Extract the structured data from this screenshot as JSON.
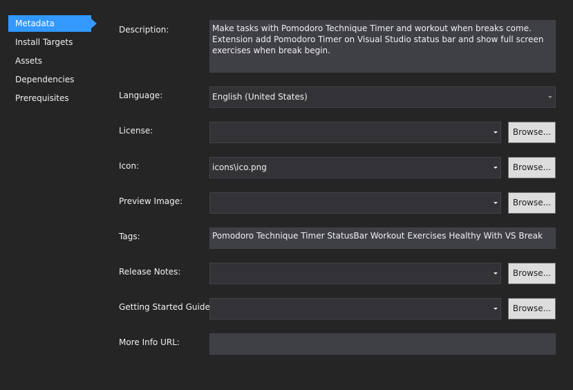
{
  "sidebar": {
    "items": [
      {
        "label": "Metadata"
      },
      {
        "label": "Install Targets"
      },
      {
        "label": "Assets"
      },
      {
        "label": "Dependencies"
      },
      {
        "label": "Prerequisites"
      }
    ],
    "selected": "Metadata"
  },
  "form": {
    "description": {
      "label": "Description:",
      "value": "Make tasks with Pomodoro Technique Timer and workout when breaks come. Extension add Pomodoro Timer on Visual Studio status bar and show full screen exercises when break begin."
    },
    "language": {
      "label": "Language:",
      "value": "English (United States)"
    },
    "license": {
      "label": "License:",
      "value": "",
      "browse": "Browse..."
    },
    "icon": {
      "label": "Icon:",
      "value": "icons\\ico.png",
      "browse": "Browse..."
    },
    "preview_image": {
      "label": "Preview Image:",
      "value": "",
      "browse": "Browse..."
    },
    "tags": {
      "label": "Tags:",
      "value": "Pomodoro Technique Timer StatusBar Workout Exercises Healthy With VS Break"
    },
    "release_notes": {
      "label": "Release Notes:",
      "value": "",
      "browse": "Browse..."
    },
    "getting_started": {
      "label": "Getting Started Guide:",
      "value": "",
      "browse": "Browse..."
    },
    "more_info_url": {
      "label": "More Info URL:",
      "value": ""
    }
  },
  "colors": {
    "background": "#252526",
    "selection": "#3399ff",
    "field": "#3f3f46",
    "button": "#dddddd"
  }
}
